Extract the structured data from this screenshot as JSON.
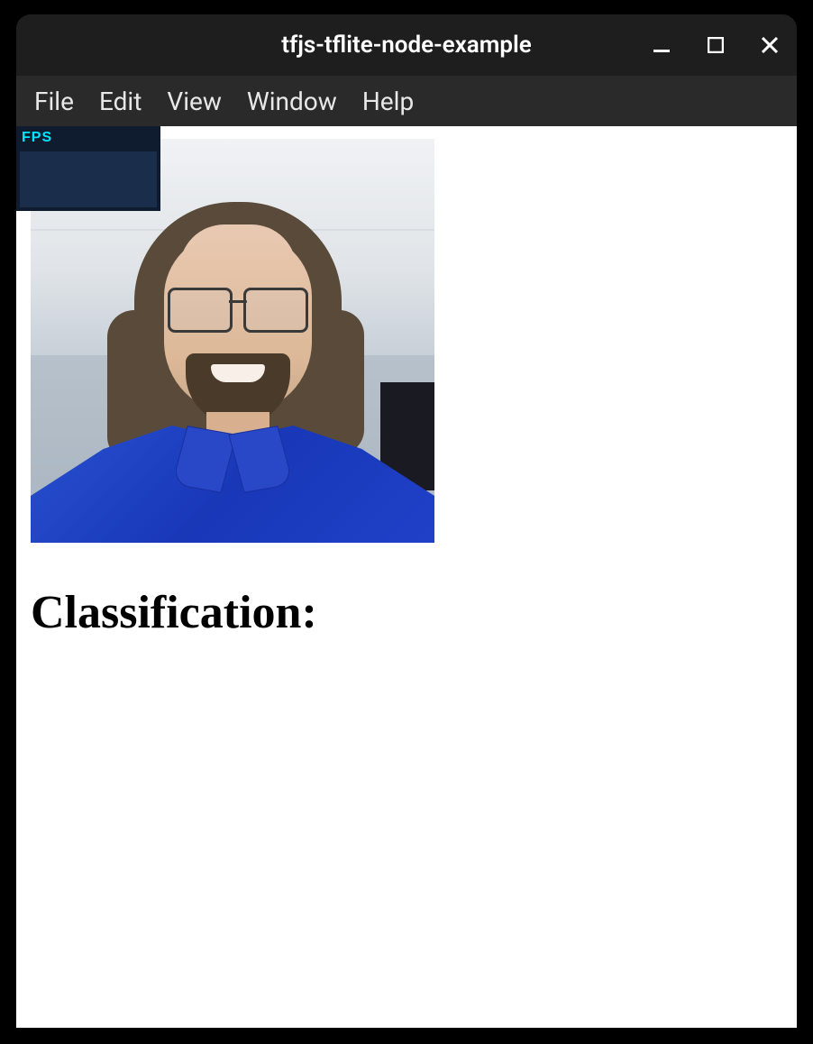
{
  "window": {
    "title": "tfjs-tflite-node-example"
  },
  "menubar": {
    "items": [
      {
        "label": "File"
      },
      {
        "label": "Edit"
      },
      {
        "label": "View"
      },
      {
        "label": "Window"
      },
      {
        "label": "Help"
      }
    ]
  },
  "fps": {
    "label": "FPS"
  },
  "content": {
    "classification_heading": "Classification:"
  }
}
